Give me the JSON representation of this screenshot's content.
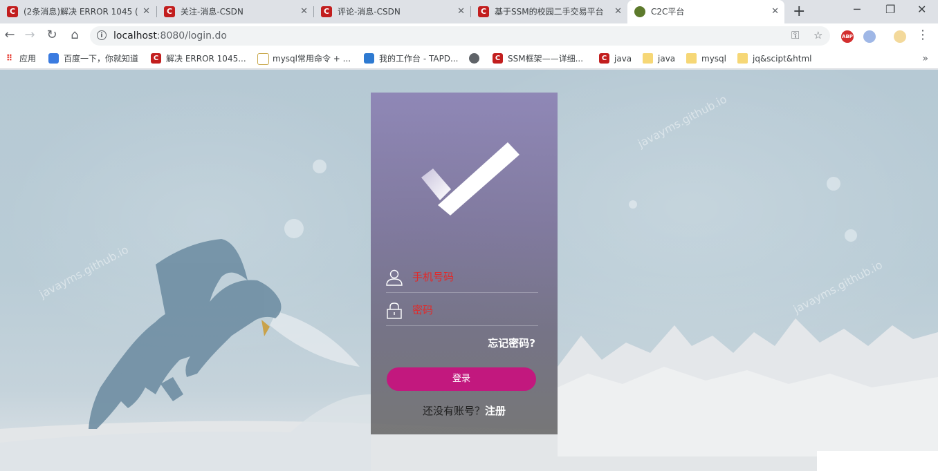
{
  "browser": {
    "tabs": [
      {
        "title": "(2条消息)解决 ERROR 1045 (",
        "icon": "csdn-icon"
      },
      {
        "title": "关注-消息-CSDN",
        "icon": "csdn-icon"
      },
      {
        "title": "评论-消息-CSDN",
        "icon": "csdn-icon"
      },
      {
        "title": "基于SSM的校园二手交易平台",
        "icon": "csdn-icon"
      },
      {
        "title": "C2C平台",
        "icon": "site-icon",
        "active": true
      }
    ],
    "favicon_letter": "C",
    "new_tab": "+",
    "window": {
      "minimize": "─",
      "restore": "❐",
      "close": "✕"
    },
    "url_host": "localhost",
    "url_rest": ":8080/login.do",
    "watermark_top": "javayms.github.io"
  },
  "bookmarks": [
    {
      "label": "应用",
      "icon": "apps-icon"
    },
    {
      "label": "百度一下，你就知道",
      "icon": "baidu-icon"
    },
    {
      "label": "解决 ERROR 1045...",
      "icon": "csdn-icon"
    },
    {
      "label": "mysql常用命令 + ...",
      "icon": "mysql-icon"
    },
    {
      "label": "我的工作台 - TAPD...",
      "icon": "tapd-icon"
    },
    {
      "label": "",
      "icon": "globe-icon"
    },
    {
      "label": "SSM框架——详细...",
      "icon": "csdn-icon"
    },
    {
      "label": "java",
      "icon": "csdn-icon"
    },
    {
      "label": "java",
      "icon": "folder-icon"
    },
    {
      "label": "mysql",
      "icon": "folder-icon"
    },
    {
      "label": "jq&scipt&html",
      "icon": "folder-icon"
    }
  ],
  "watermarks": [
    "javayms.github.io",
    "javayms.github.io",
    "javayms.github.io"
  ],
  "login": {
    "phone_placeholder": "手机号码",
    "password_placeholder": "密码",
    "forgot": "忘记密码?",
    "login_button": "登录",
    "no_account": "还没有账号？",
    "register": "注册"
  },
  "colors": {
    "accent": "#c2187e",
    "placeholder": "#e02a2a",
    "panel_top": "#8c82b4",
    "csdn_red": "#c21e1e"
  }
}
